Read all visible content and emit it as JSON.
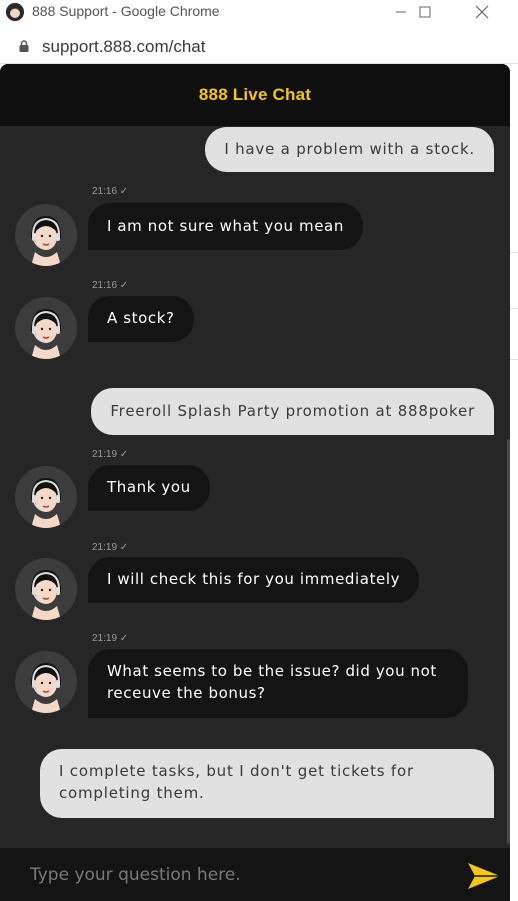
{
  "window": {
    "title": "888 Support - Google Chrome",
    "url": "support.888.com/chat",
    "controls": {
      "minimize": "—",
      "maximize": "☐",
      "close": "✕"
    }
  },
  "chat": {
    "header_title": "888 Live Chat",
    "input_placeholder": "Type your question here.",
    "accent_color": "#f5c518",
    "messages": [
      {
        "from": "user",
        "text": "I have a problem with a stock."
      },
      {
        "from": "agent",
        "time": "21:16 ✓",
        "text": "I am not sure what you mean"
      },
      {
        "from": "agent",
        "time": "21:16 ✓",
        "text": "A stock?"
      },
      {
        "from": "user",
        "text": "Freeroll Splash Party promotion at 888poker"
      },
      {
        "from": "agent",
        "time": "21:19 ✓",
        "text": "Thank you"
      },
      {
        "from": "agent",
        "time": "21:19 ✓",
        "text": "I will check this for you immediately"
      },
      {
        "from": "agent",
        "time": "21:19 ✓",
        "text": "What seems to be the issue? did you not receuve the bonus?"
      },
      {
        "from": "user",
        "text": "I complete tasks, but I don't get tickets for completing them."
      }
    ]
  }
}
